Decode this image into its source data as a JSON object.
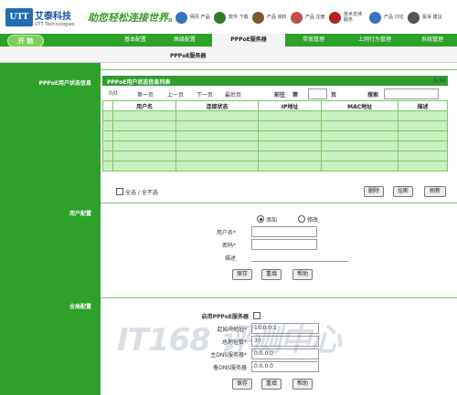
{
  "brand": {
    "logo_text": "UTT",
    "name_cn": "艾泰科技",
    "name_en": "UTT Technologies",
    "slogan": "助您轻松连接世界。",
    "color_accent": "#2da12a"
  },
  "header_nav": [
    {
      "label": "网页 产品",
      "icon": "search-icon",
      "color": "#3a70c0"
    },
    {
      "label": "软件 下载",
      "icon": "download-icon",
      "color": "#2e7d2e"
    },
    {
      "label": "产品 资料",
      "icon": "graduation-icon",
      "color": "#7a5a2a"
    },
    {
      "label": "产品 注册",
      "icon": "register-icon",
      "color": "#c0504d"
    },
    {
      "label": "技术支持 服务",
      "icon": "phone-icon",
      "color": "#b22222"
    },
    {
      "label": "产品 讨论",
      "icon": "forum-icon",
      "color": "#3a70c0"
    },
    {
      "label": "投诉 建议",
      "icon": "user-icon",
      "color": "#555555"
    }
  ],
  "nav": {
    "start_label": "开 始",
    "tabs": [
      "基本配置",
      "高级配置",
      "PPPoE服务器",
      "带宽管理",
      "上网行为管理",
      "系统管理"
    ],
    "active_tab": "PPPoE服务器",
    "subtab": "PPPoE服务器"
  },
  "status_section": {
    "side_title": "PPPoE用户状态信息",
    "list_title": "PPPoE用户状态信息列表",
    "count": "0/30",
    "page_info": "0/0",
    "first": "第一页",
    "prev": "上一页",
    "next": "下一页",
    "last": "最后页",
    "goto_prefix": "前往",
    "goto_page": "第",
    "goto_suffix": "页",
    "search_label": "搜索",
    "columns": [
      "",
      "用户名",
      "连接状态",
      "IP地址",
      "MAC地址",
      "描述"
    ],
    "select_all": "全选 / 全不选",
    "delete_btn": "删除",
    "hangup_btn": "挂断",
    "refresh_btn": "刷新"
  },
  "user_config": {
    "side_title": "用户配置",
    "add_label": "添加",
    "edit_label": "修改",
    "username_label": "用户名",
    "password_label": "密码",
    "desc_label": "描述",
    "save_btn": "保存",
    "reset_btn": "重填",
    "help_btn": "帮助"
  },
  "global_config": {
    "side_title": "全局配置",
    "enable_label": "启用PPPoE服务器",
    "start_ip_label": "起始IP地址",
    "start_ip_value": "10.0.0.1",
    "total_label": "总地址数",
    "total_value": "30",
    "dns1_label": "主DNS服务器",
    "dns1_value": "0.0.0.0",
    "dns2_label": "备DNS服务器",
    "dns2_value": "0.0.0.0",
    "save_btn": "保存",
    "reset_btn": "重填",
    "help_btn": "帮助"
  },
  "watermark": "IT168 评测中心"
}
